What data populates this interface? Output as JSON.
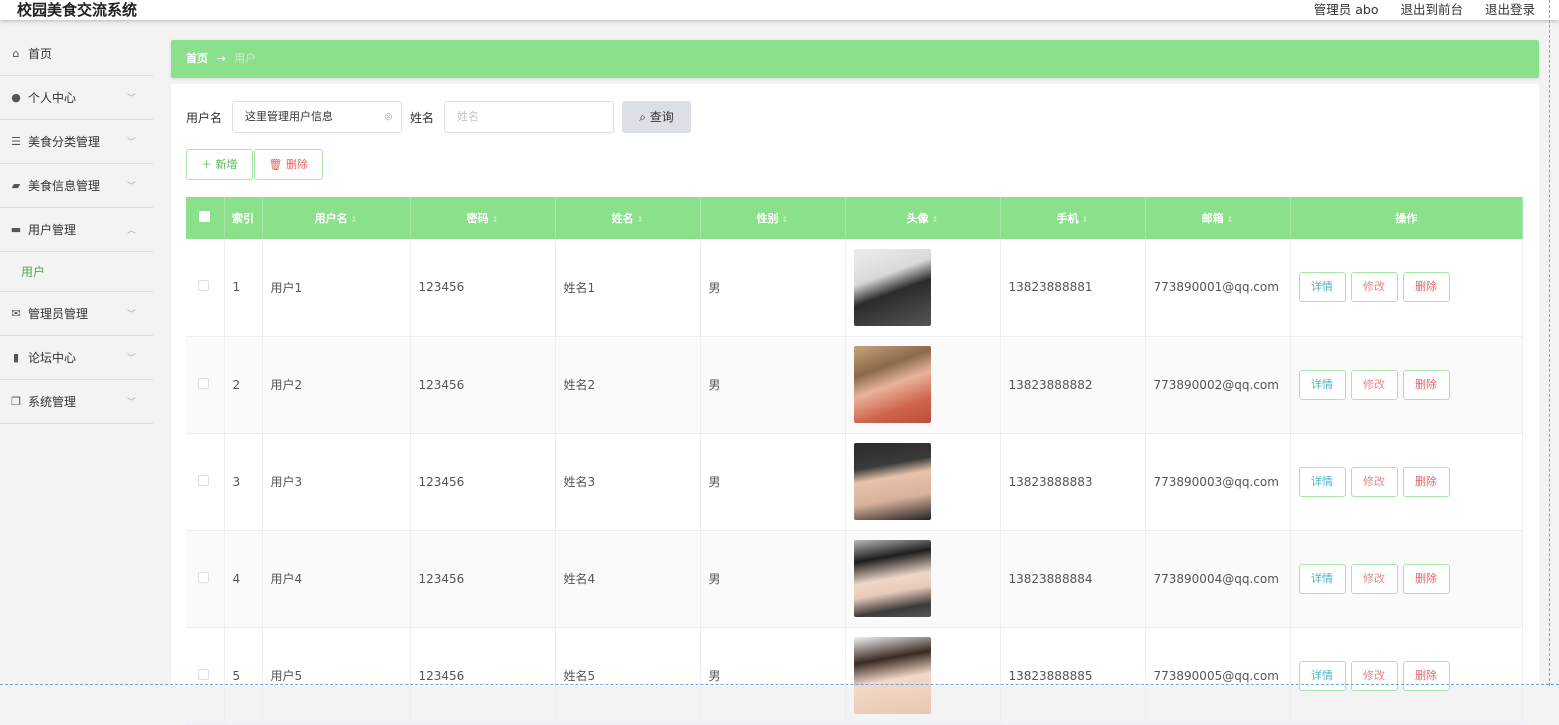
{
  "app": {
    "title": "校园美食交流系统",
    "admin_label": "管理员 abo",
    "frontend_link": "退出到前台",
    "logout_link": "退出登录"
  },
  "sidebar": {
    "items": [
      {
        "label": "首页",
        "icon": "home-icon"
      },
      {
        "label": "个人中心",
        "icon": "user-icon"
      },
      {
        "label": "美食分类管理",
        "icon": "sliders-icon"
      },
      {
        "label": "美食信息管理",
        "icon": "tag-icon"
      },
      {
        "label": "用户管理",
        "icon": "users-icon"
      },
      {
        "label": "用户",
        "icon": ""
      },
      {
        "label": "管理员管理",
        "icon": "mail-icon"
      },
      {
        "label": "论坛中心",
        "icon": "chart-icon"
      },
      {
        "label": "系统管理",
        "icon": "copy-icon"
      }
    ]
  },
  "breadcrumb": {
    "home": "首页",
    "arrow": "→",
    "current": "用户"
  },
  "search": {
    "username_label": "用户名",
    "username_value": "这里管理用户信息",
    "name_label": "姓名",
    "name_placeholder": "姓名",
    "query_button": "查询"
  },
  "actions": {
    "add": "新增",
    "delete": "删除"
  },
  "table": {
    "headers": [
      "索引",
      "用户名",
      "密码",
      "姓名",
      "性别",
      "头像",
      "手机",
      "邮箱",
      "操作"
    ],
    "rows": [
      {
        "index": "1",
        "username": "用户1",
        "password": "123456",
        "name": "姓名1",
        "gender": "男",
        "phone": "13823888881",
        "email": "773890001@qq.com"
      },
      {
        "index": "2",
        "username": "用户2",
        "password": "123456",
        "name": "姓名2",
        "gender": "男",
        "phone": "13823888882",
        "email": "773890002@qq.com"
      },
      {
        "index": "3",
        "username": "用户3",
        "password": "123456",
        "name": "姓名3",
        "gender": "男",
        "phone": "13823888883",
        "email": "773890003@qq.com"
      },
      {
        "index": "4",
        "username": "用户4",
        "password": "123456",
        "name": "姓名4",
        "gender": "男",
        "phone": "13823888884",
        "email": "773890004@qq.com"
      },
      {
        "index": "5",
        "username": "用户5",
        "password": "123456",
        "name": "姓名5",
        "gender": "男",
        "phone": "13823888885",
        "email": "773890005@qq.com"
      }
    ],
    "op_labels": {
      "detail": "详情",
      "edit": "修改",
      "delete": "删除"
    }
  },
  "colors": {
    "accent": "#8be08b",
    "active_menu": "#4cae4c"
  }
}
